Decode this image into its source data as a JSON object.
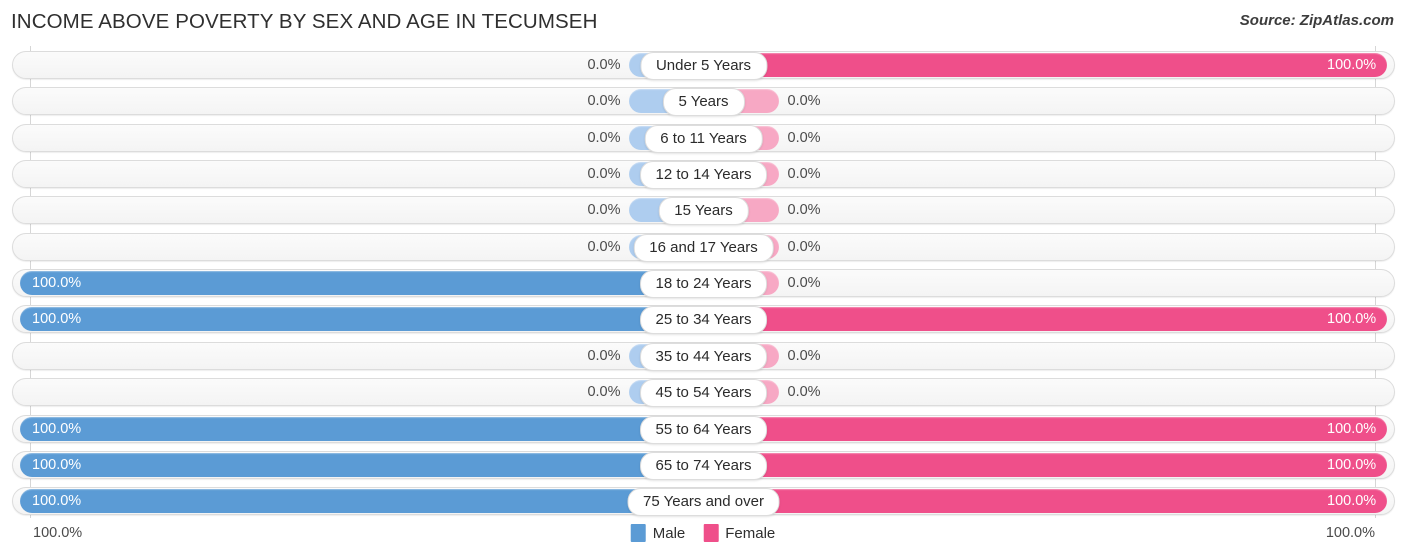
{
  "header": {
    "title": "INCOME ABOVE POVERTY BY SEX AND AGE IN TECUMSEH",
    "source": "Source: ZipAtlas.com"
  },
  "legend": {
    "male": {
      "label": "Male",
      "color": "#5b9bd5"
    },
    "female": {
      "label": "Female",
      "color": "#ef4f8a"
    }
  },
  "axis": {
    "left_max": "100.0%",
    "right_max": "100.0%"
  },
  "colors": {
    "male_full": "#5b9bd5",
    "male_zero": "#aecdef",
    "female_full": "#ef4f8a",
    "female_zero": "#f7a8c4",
    "track_border": "#dcdcdc",
    "gridline": "#d6d6d6"
  },
  "chart_data": {
    "type": "bar",
    "subtype": "diverging-population-pyramid",
    "title": "INCOME ABOVE POVERTY BY SEX AND AGE IN TECUMSEH",
    "xlabel": "",
    "ylabel": "",
    "xlim": [
      0,
      100
    ],
    "unit": "%",
    "grid": true,
    "legend_position": "bottom-center",
    "categories": [
      "Under 5 Years",
      "5 Years",
      "6 to 11 Years",
      "12 to 14 Years",
      "15 Years",
      "16 and 17 Years",
      "18 to 24 Years",
      "25 to 34 Years",
      "35 to 44 Years",
      "45 to 54 Years",
      "55 to 64 Years",
      "65 to 74 Years",
      "75 Years and over"
    ],
    "series": [
      {
        "name": "Male",
        "direction": "left",
        "color": "#5b9bd5",
        "values": [
          0.0,
          0.0,
          0.0,
          0.0,
          0.0,
          0.0,
          100.0,
          100.0,
          0.0,
          0.0,
          100.0,
          100.0,
          100.0
        ],
        "labels": [
          "0.0%",
          "0.0%",
          "0.0%",
          "0.0%",
          "0.0%",
          "0.0%",
          "100.0%",
          "100.0%",
          "0.0%",
          "0.0%",
          "100.0%",
          "100.0%",
          "100.0%"
        ]
      },
      {
        "name": "Female",
        "direction": "right",
        "color": "#ef4f8a",
        "values": [
          100.0,
          0.0,
          0.0,
          0.0,
          0.0,
          0.0,
          0.0,
          100.0,
          0.0,
          0.0,
          100.0,
          100.0,
          100.0
        ],
        "labels": [
          "100.0%",
          "0.0%",
          "0.0%",
          "0.0%",
          "0.0%",
          "0.0%",
          "0.0%",
          "100.0%",
          "0.0%",
          "0.0%",
          "100.0%",
          "100.0%",
          "100.0%"
        ]
      }
    ]
  }
}
